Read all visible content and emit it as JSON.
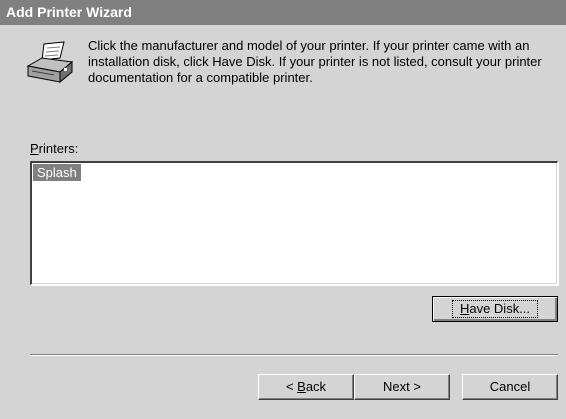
{
  "window": {
    "title": "Add Printer Wizard"
  },
  "icons": {
    "printer": "printer-icon"
  },
  "instructions": {
    "text": "Click the manufacturer and model of your printer. If your printer came with an installation disk, click Have Disk. If your printer is not listed, consult your printer documentation for a compatible printer."
  },
  "printers": {
    "label_mnemonic": "P",
    "label_rest": "rinters:",
    "items": [
      "Splash"
    ],
    "selected": "Splash"
  },
  "buttons": {
    "have_disk_mnemonic": "H",
    "have_disk_rest": "ave Disk...",
    "back_prefix": "< ",
    "back_mnemonic": "B",
    "back_rest": "ack",
    "next": "Next >",
    "cancel": "Cancel"
  },
  "colors": {
    "face": "#d4d4d4",
    "titlebar": "#808080",
    "selection": "#808080"
  }
}
